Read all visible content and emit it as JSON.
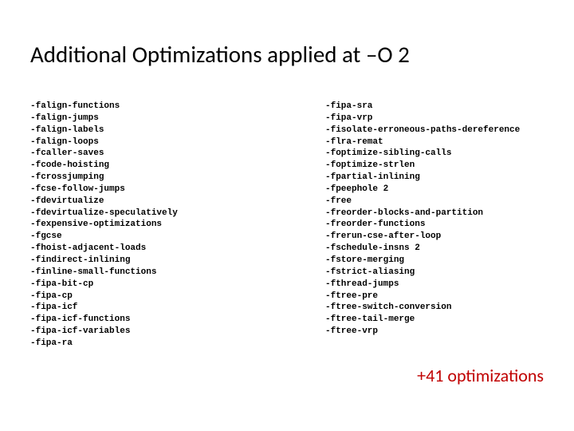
{
  "title": "Additional Optimizations applied at –O 2",
  "left_flags": [
    "-falign-functions",
    "-falign-jumps",
    "-falign-labels",
    "-falign-loops",
    "-fcaller-saves",
    "-fcode-hoisting",
    "-fcrossjumping",
    "-fcse-follow-jumps",
    "-fdevirtualize",
    "-fdevirtualize-speculatively",
    "-fexpensive-optimizations",
    "-fgcse",
    "-fhoist-adjacent-loads",
    "-findirect-inlining",
    "-finline-small-functions",
    "-fipa-bit-cp",
    "-fipa-cp",
    "-fipa-icf",
    "-fipa-icf-functions",
    "-fipa-icf-variables",
    "-fipa-ra"
  ],
  "right_flags": [
    "-fipa-sra",
    "-fipa-vrp",
    "-fisolate-erroneous-paths-dereference",
    "-flra-remat",
    "-foptimize-sibling-calls",
    "-foptimize-strlen",
    "-fpartial-inlining",
    "-fpeephole 2",
    "-free",
    "-freorder-blocks-and-partition",
    "-freorder-functions",
    "-frerun-cse-after-loop",
    "-fschedule-insns 2",
    "-fstore-merging",
    "-fstrict-aliasing",
    "-fthread-jumps",
    "-ftree-pre",
    "-ftree-switch-conversion",
    "-ftree-tail-merge",
    "-ftree-vrp"
  ],
  "summary": "+41 optimizations"
}
